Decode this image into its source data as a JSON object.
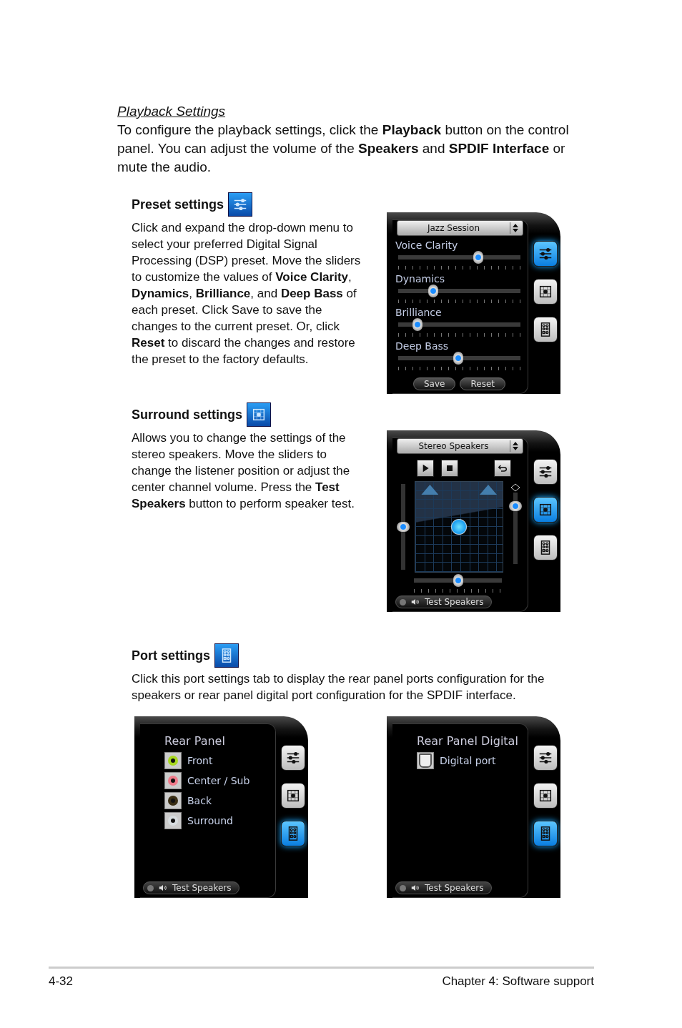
{
  "section_title": "Playback Settings",
  "intro": "To configure the playback settings, click the **Playback** button on the control panel. You can adjust the volume of the **Speakers** and **SPDIF Interface** or mute the audio.",
  "sections": [
    {
      "kind": "preset",
      "heading": "Preset settings",
      "body": "Click and expand the drop-down menu to select your preferred Digital Signal Processing (DSP) preset. Move the sliders to customize the values of **Voice Clarity**, **Dynamics**, **Brilliance**, and **Deep Bass** of each preset. Click Save to save the changes to the current preset. Or, click **Reset** to discard the changes and restore the preset to the factory defaults.",
      "panels": [
        {
          "kind": "preset",
          "dropdown": "Jazz Session",
          "tabs": [
            {
              "selected": true
            },
            {
              "selected": false
            },
            {
              "selected": false
            }
          ],
          "sliders": [
            {
              "label": "Voice Clarity",
              "level": 0.67
            },
            {
              "label": "Dynamics",
              "level": 0.27
            },
            {
              "label": "Brilliance",
              "level": 0.13
            },
            {
              "label": "Deep Bass",
              "level": 0.49
            }
          ],
          "buttons": [
            "Save",
            "Reset"
          ]
        }
      ]
    },
    {
      "kind": "surround",
      "heading": "Surround settings",
      "body": "Allows you to change the settings of the stereo speakers. Move the sliders to change the listener position or adjust the center channel volume. Press the **Test Speakers** button to perform speaker test.",
      "panels": [
        {
          "kind": "surround",
          "dropdown": "Stereo Speakers",
          "tabs": [
            {
              "selected": false
            },
            {
              "selected": true
            },
            {
              "selected": false
            }
          ],
          "left_slider": {
            "level": 0.5
          },
          "right_slider": {
            "level": 0.86
          },
          "bottom_slider": {
            "level": 0.5
          },
          "test_button": "Test Speakers"
        }
      ]
    },
    {
      "kind": "port",
      "heading": "Port settings",
      "body": "Click this port settings tab to display the rear panel ports configuration for the speakers or rear panel digital port configuration for the SPDIF interface.",
      "panels": [
        {
          "kind": "ports",
          "title": "Rear Panel",
          "tabs": [
            {
              "selected": false
            },
            {
              "selected": false
            },
            {
              "selected": true
            }
          ],
          "ports": [
            {
              "kind": "jack",
              "label": "Front",
              "color": "#a8d820"
            },
            {
              "kind": "jack",
              "label": "Center / Sub",
              "color": "#f07a8a"
            },
            {
              "kind": "jack",
              "label": "Back",
              "color": "#3a2e14"
            },
            {
              "kind": "jack",
              "label": "Surround",
              "color": "#d8dde0"
            }
          ],
          "test_button": "Test Speakers"
        },
        {
          "kind": "ports",
          "title": "Rear Panel Digital",
          "tabs": [
            {
              "selected": false
            },
            {
              "selected": false
            },
            {
              "selected": true
            }
          ],
          "ports": [
            {
              "kind": "optical",
              "label": "Digital port"
            }
          ],
          "test_button": "Test Speakers"
        }
      ]
    }
  ],
  "footer": {
    "page_number": "4-32",
    "chapter": "Chapter 4: Software support"
  }
}
